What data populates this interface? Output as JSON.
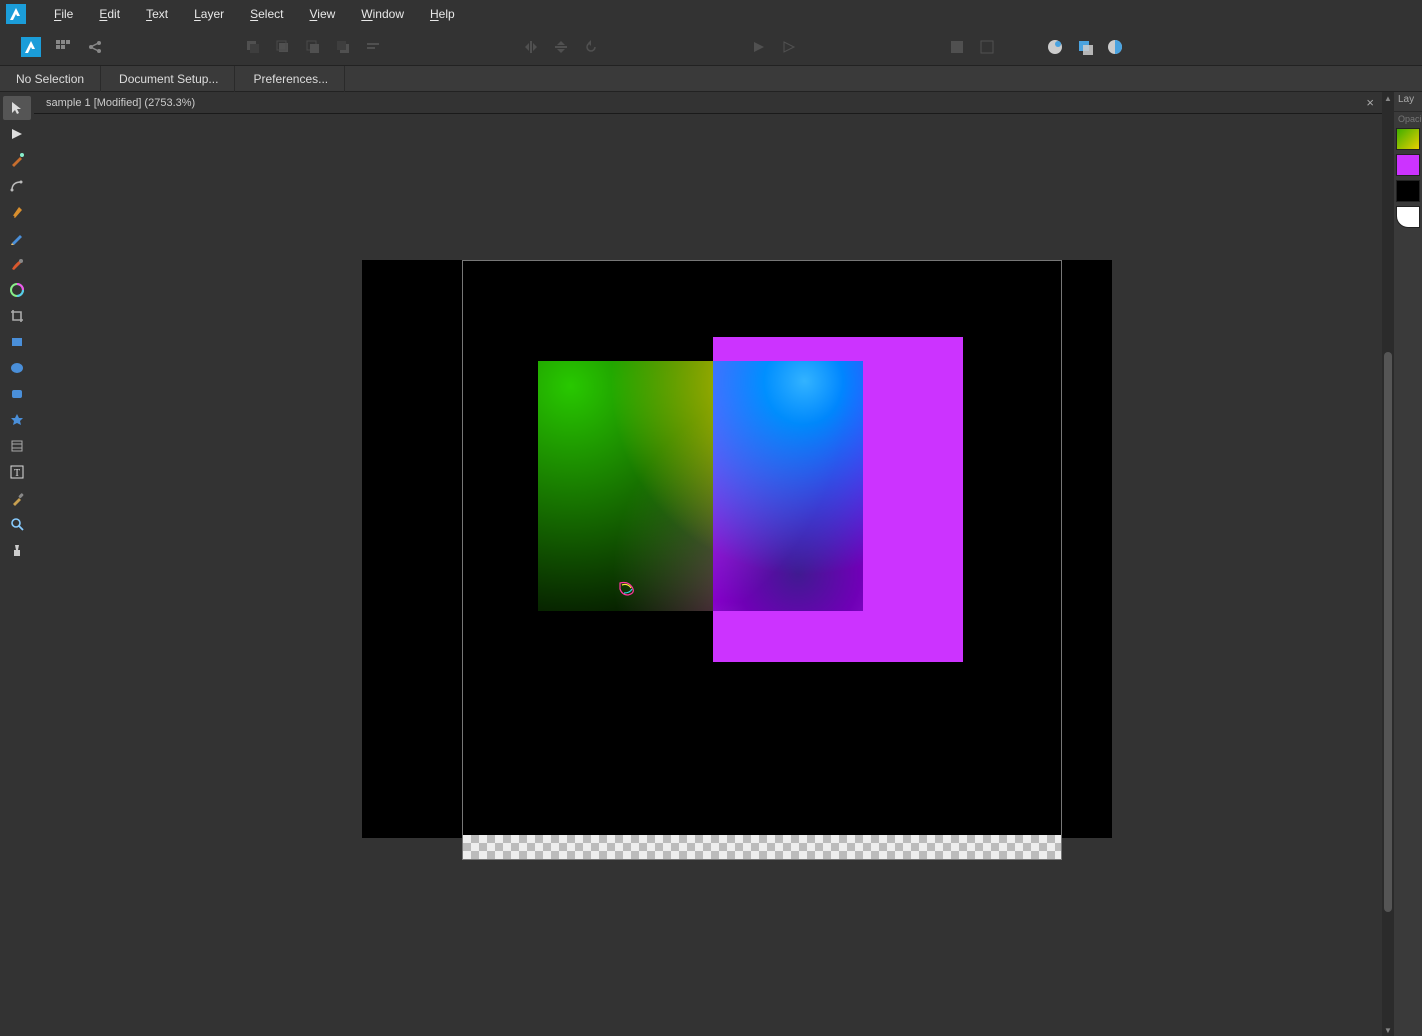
{
  "menubar": {
    "items": [
      {
        "label": "File",
        "mn": "F"
      },
      {
        "label": "Edit",
        "mn": "E"
      },
      {
        "label": "Text",
        "mn": "T"
      },
      {
        "label": "Layer",
        "mn": "L"
      },
      {
        "label": "Select",
        "mn": "S"
      },
      {
        "label": "View",
        "mn": "V"
      },
      {
        "label": "Window",
        "mn": "W"
      },
      {
        "label": "Help",
        "mn": "H"
      }
    ]
  },
  "contextbar": {
    "items": [
      "No Selection",
      "Document Setup...",
      "Preferences..."
    ]
  },
  "document": {
    "tab_label": "sample 1 [Modified] (2753.3%)",
    "close_glyph": "×"
  },
  "tools": [
    {
      "name": "move-tool",
      "glyph": "cursor",
      "active": true
    },
    {
      "name": "node-tool",
      "glyph": "play"
    },
    {
      "name": "point-transform-tool",
      "glyph": "wand"
    },
    {
      "name": "corner-tool",
      "glyph": "corner"
    },
    {
      "name": "pen-tool",
      "glyph": "pen"
    },
    {
      "name": "pencil-tool",
      "glyph": "pencil"
    },
    {
      "name": "brush-tool",
      "glyph": "brush"
    },
    {
      "name": "fill-tool",
      "glyph": "fill"
    },
    {
      "name": "crop-tool",
      "glyph": "crop"
    },
    {
      "name": "rectangle-tool",
      "glyph": "rect"
    },
    {
      "name": "ellipse-tool",
      "glyph": "ellipse"
    },
    {
      "name": "rounded-rect-tool",
      "glyph": "rrect"
    },
    {
      "name": "star-tool",
      "glyph": "star"
    },
    {
      "name": "artboard-tool",
      "glyph": "artboard"
    },
    {
      "name": "text-tool",
      "glyph": "text"
    },
    {
      "name": "eyedropper-tool",
      "glyph": "eyedrop"
    },
    {
      "name": "zoom-tool",
      "glyph": "zoom"
    },
    {
      "name": "view-tool",
      "glyph": "glass"
    }
  ],
  "rightpanel": {
    "tab_label": "Lay",
    "sub_label": "Opaci",
    "swatches": [
      {
        "name": "layer-swatch-gradient",
        "cls": "sw-grad"
      },
      {
        "name": "layer-swatch-magenta",
        "cls": "sw-mag"
      },
      {
        "name": "layer-swatch-black",
        "cls": "sw-blk"
      },
      {
        "name": "layer-swatch-white",
        "cls": "sw-wht"
      }
    ]
  },
  "canvas": {
    "bg_color": "#000000",
    "magenta_color": "#cc33ff",
    "gradient_blend_mode": "difference"
  }
}
